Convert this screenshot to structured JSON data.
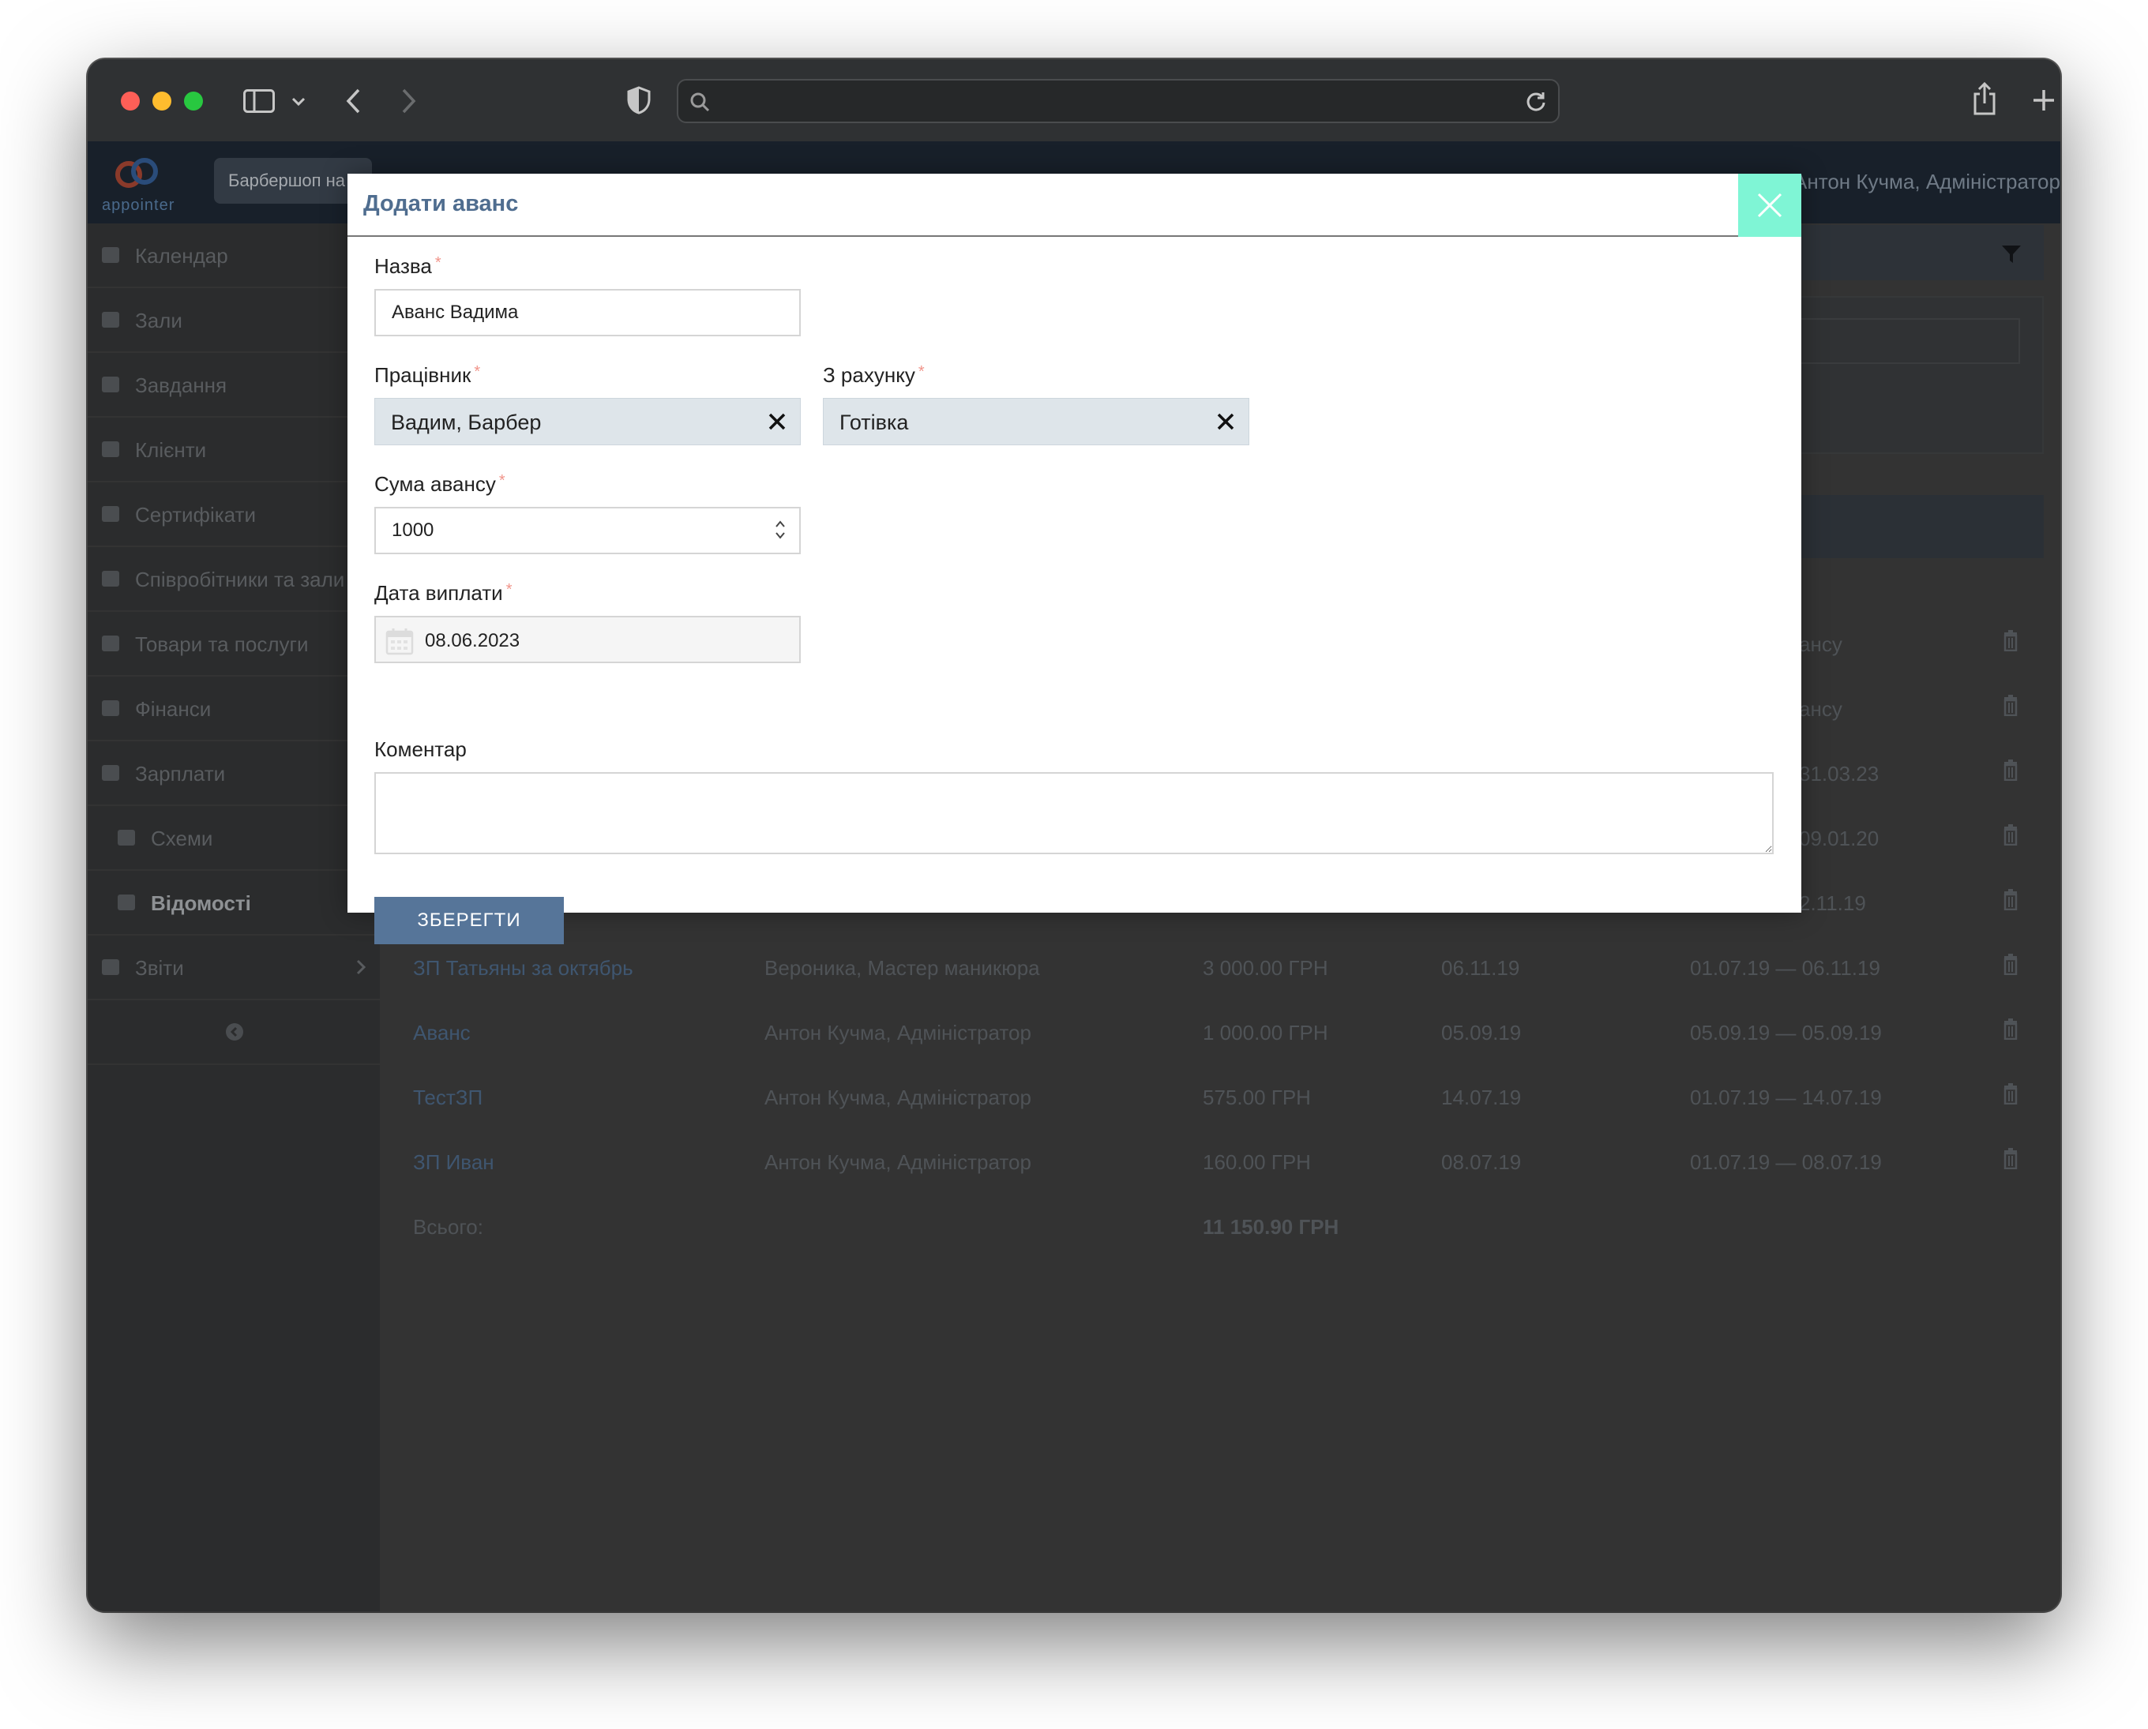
{
  "browser": {
    "address": ""
  },
  "app": {
    "logo_text": "appointer",
    "company_selector": "Барбершоп на",
    "user_menu": "Антон Кучма, Адміністратор"
  },
  "sidebar": {
    "items": [
      {
        "label": "Календар",
        "icon": "calendar-icon"
      },
      {
        "label": "Зали",
        "icon": "bookmark-icon"
      },
      {
        "label": "Завдання",
        "icon": "tasks-icon"
      },
      {
        "label": "Клієнти",
        "icon": "users-icon"
      },
      {
        "label": "Сертифікати",
        "icon": "card-icon"
      },
      {
        "label": "Співробітники та зали",
        "icon": "id-card-icon"
      },
      {
        "label": "Товари та послуги",
        "icon": "card-icon"
      },
      {
        "label": "Фінанси",
        "icon": "money-icon"
      },
      {
        "label": "Зарплати",
        "icon": "calculator-icon"
      },
      {
        "label": "Схеми",
        "icon": "sitemap-icon"
      },
      {
        "label": "Відомості",
        "icon": "table-icon"
      },
      {
        "label": "Звіти",
        "icon": "bar-chart-icon"
      }
    ]
  },
  "table": {
    "rows": [
      {
        "name": "",
        "employee": "",
        "sum": "",
        "date": "",
        "period": "ансу"
      },
      {
        "name": "",
        "employee": "",
        "sum": "",
        "date": "",
        "period": "ансу"
      },
      {
        "name": "",
        "employee": "",
        "sum": "",
        "date": "",
        "period": "31.03.23"
      },
      {
        "name": "",
        "employee": "",
        "sum": "",
        "date": "",
        "period": "09.01.20"
      },
      {
        "name": "",
        "employee": "",
        "sum": "",
        "date": "",
        "period": "2.11.19"
      },
      {
        "name": "ЗП Татьяны за октябрь",
        "employee": "Вероника, Мастер маникюра",
        "sum": "3 000.00 ГРН",
        "date": "06.11.19",
        "period": "01.07.19 — 06.11.19"
      },
      {
        "name": "Аванс",
        "employee": "Антон Кучма, Адміністратор",
        "sum": "1 000.00 ГРН",
        "date": "05.09.19",
        "period": "05.09.19 — 05.09.19"
      },
      {
        "name": "ТестЗП",
        "employee": "Антон Кучма, Адміністратор",
        "sum": "575.00 ГРН",
        "date": "14.07.19",
        "period": "01.07.19 — 14.07.19"
      },
      {
        "name": "ЗП Иван",
        "employee": "Антон Кучма, Адміністратор",
        "sum": "160.00 ГРН",
        "date": "08.07.19",
        "period": "01.07.19 — 08.07.19"
      }
    ],
    "total_label": "Всього:",
    "total_value": "11 150.90 ГРН"
  },
  "modal": {
    "title": "Додати аванс",
    "name_label": "Назва",
    "name_value": "Аванс Вадима",
    "employee_label": "Працівник",
    "employee_value": "Вадим, Барбер",
    "account_label": "З рахунку",
    "account_value": "Готівка",
    "amount_label": "Сума авансу",
    "amount_value": "1000",
    "date_label": "Дата виплати",
    "date_value": "08.06.2023",
    "comment_label": "Коментар",
    "comment_value": "",
    "save_label": "ЗБЕРЕГТИ",
    "required_mark": "*"
  },
  "colors": {
    "modal_title": "#4f6d8f",
    "close_button": "#7ff5d5",
    "save_button": "#567599",
    "select_background": "#dee5ea",
    "required_mark": "#f1948a"
  }
}
